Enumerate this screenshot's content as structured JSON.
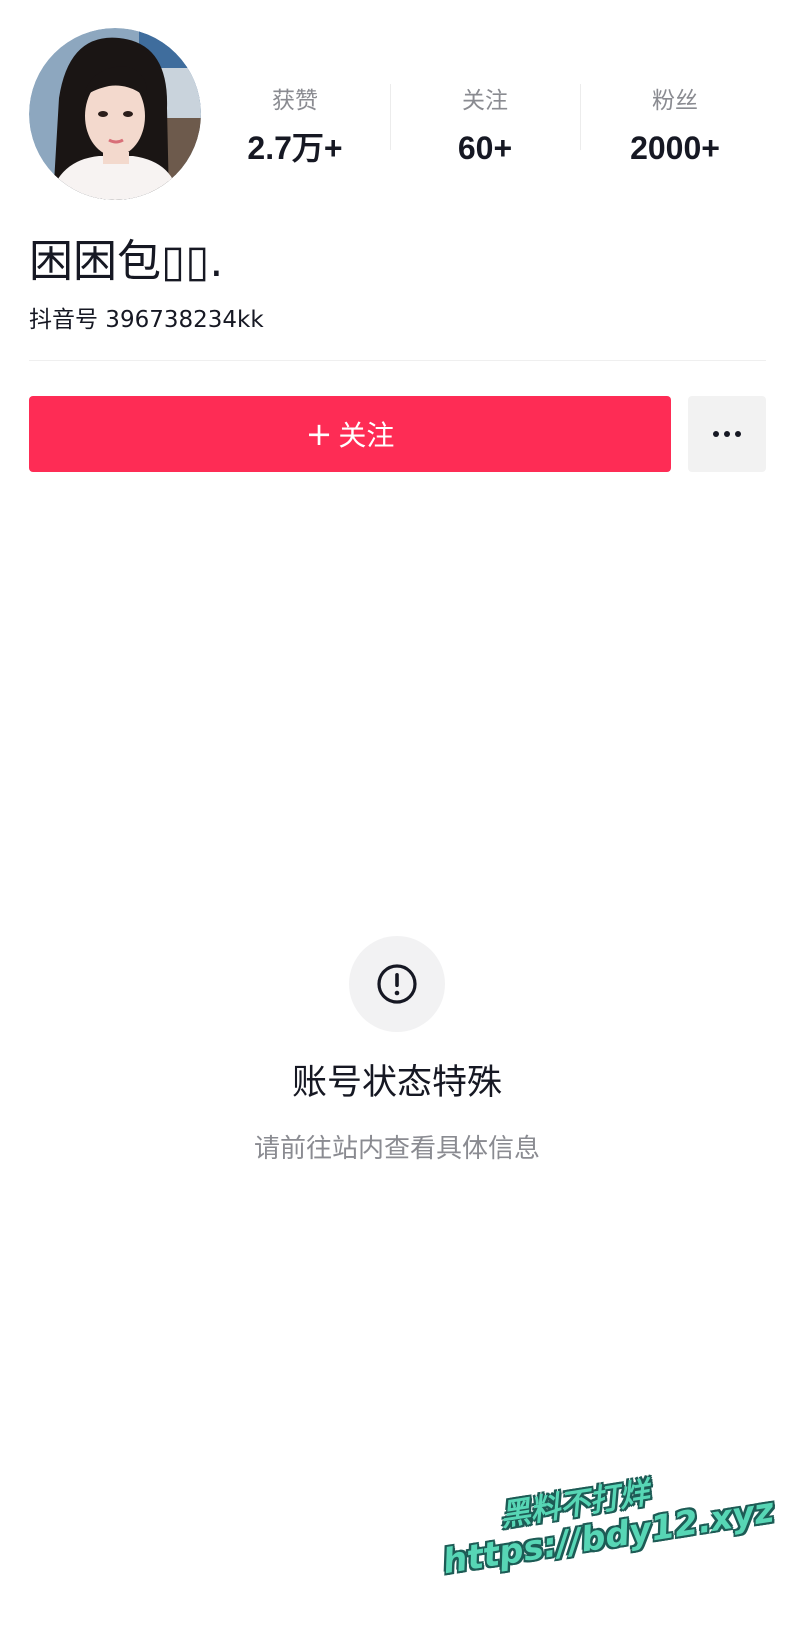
{
  "profile": {
    "avatar_alt": "avatar",
    "nickname": "困困包▯▯.",
    "account_id": "抖音号 396738234kk"
  },
  "stats": [
    {
      "label": "获赞",
      "value": "2.7万+"
    },
    {
      "label": "关注",
      "value": "60+"
    },
    {
      "label": "粉丝",
      "value": "2000+"
    }
  ],
  "actions": {
    "follow_plus": "+",
    "follow_label": "关注",
    "more_icon": "more-dots-icon"
  },
  "status": {
    "icon": "exclamation-circle-icon",
    "title": "账号状态特殊",
    "description": "请前往站内查看具体信息"
  },
  "watermark": {
    "line1": "黑料不打烊",
    "line2": "https://bdy12.xyz"
  },
  "colors": {
    "accent": "#fe2c55",
    "watermark": "#57d6b5"
  }
}
